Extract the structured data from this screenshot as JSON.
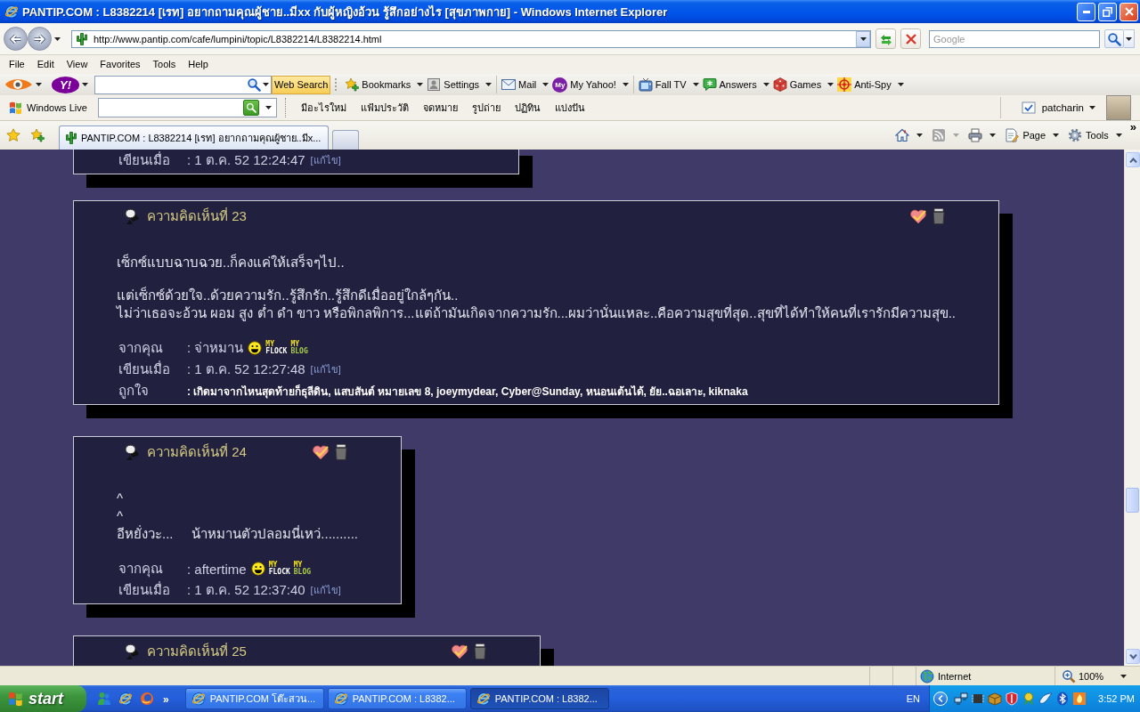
{
  "window": {
    "title": "PANTIP.COM : L8382214 [เรท] อยากถามคุณผู้ชาย..มีxx กับผู้หญิงอ้วน รู้สึกอย่างไร [สุขภาพกาย] - Windows Internet Explorer"
  },
  "address_bar": {
    "url": "http://www.pantip.com/cafe/lumpini/topic/L8382214/L8382214.html"
  },
  "search": {
    "placeholder": "Google"
  },
  "menu": [
    "File",
    "Edit",
    "View",
    "Favorites",
    "Tools",
    "Help"
  ],
  "yahoo_toolbar": {
    "logo": "Y!",
    "search_button": "Web Search",
    "items": [
      {
        "kind": "button",
        "label": "Bookmarks"
      },
      {
        "kind": "button",
        "label": "Settings"
      },
      {
        "kind": "separator"
      },
      {
        "kind": "button",
        "label": "Mail"
      },
      {
        "kind": "button",
        "label": "My Yahoo!",
        "logo": "My"
      },
      {
        "kind": "separator"
      },
      {
        "kind": "button",
        "label": "Fall TV"
      },
      {
        "kind": "button",
        "label": "Answers"
      },
      {
        "kind": "button",
        "label": "Games"
      },
      {
        "kind": "button",
        "label": "Anti-Spy"
      }
    ]
  },
  "live_toolbar": {
    "brand": "Windows Live",
    "links": [
      "มีอะไรใหม่",
      "แฟ้มประวัติ",
      "จดหมาย",
      "รูปถ่าย",
      "ปฏิทิน",
      "แบ่งปัน"
    ],
    "user": "patcharin"
  },
  "tabs": [
    {
      "label": "PANTIP.COM : L8382214 [เรท] อยากถามคุณผู้ชาย..มีx...",
      "selected": true
    }
  ],
  "command_bar": {
    "items": [
      {
        "disabled": false
      },
      {
        "disabled": true
      },
      {
        "disabled": false
      },
      {
        "label": "Page",
        "disabled": false
      },
      {
        "label": "Tools",
        "disabled": false
      }
    ],
    "more": "»"
  },
  "comments": [
    {
      "meta": [
        {
          "kind": "written",
          "label": "เขียนเมื่อ",
          "value": ": 1 ต.ค. 52 12:24:47",
          "edit": "[แก้ไข]"
        }
      ]
    },
    {
      "title": "ความคิดเห็นที่ 23",
      "body": [
        [
          "เซ็กซ์แบบฉาบฉวย..ก็คงแค่ให้เสร็จๆไป.."
        ],
        [
          "แต่เซ็กซ์ด้วยใจ..ด้วยความรัก..รู้สึกรัก..รู้สึกดีเมื่ออยู่ใกล้ๆกัน..",
          "ไม่ว่าเธอจะอ้วน ผอม สูง ต่ำ ดำ ขาว หรือพิกลพิการ...แต่ถ้ามันเกิดจากความรัก...ผมว่านั่นแหละ..คือความสุขที่สุด..สุขที่ได้ทำให้คนที่เรารักมีความสุข.."
        ]
      ],
      "meta": [
        {
          "kind": "author",
          "label": "จากคุณ",
          "value": ": จ่าหมาน",
          "logos": [
            {
              "top": "MY",
              "bottom": "FLOCK"
            },
            {
              "top": "MY",
              "bottom": "BLOG"
            }
          ]
        },
        {
          "kind": "written",
          "label": "เขียนเมื่อ",
          "value": ": 1 ต.ค. 52 12:27:48",
          "edit": "[แก้ไข]"
        },
        {
          "kind": "likes",
          "label": "ถูกใจ",
          "value": ": เกิดมาจากไหนสุดท้ายก็ธุลีดิน, แสบสันต์ หมายเลข 8, joeymydear, Cyber@Sunday, หนอนเต้นได้, ยัย..ฉอเลาะ, kiknaka"
        }
      ]
    },
    {
      "title": "ความคิดเห็นที่ 24",
      "body": [
        [
          "^",
          "^",
          "อีหยั่งวะ...     น้าหมานตัวปลอมนี่เหว่.........."
        ]
      ],
      "meta": [
        {
          "kind": "author",
          "label": "จากคุณ",
          "value": ": aftertime",
          "logos": [
            {
              "top": "MY",
              "bottom": "FLOCK"
            },
            {
              "top": "MY",
              "bottom": "BLOG"
            }
          ]
        },
        {
          "kind": "written",
          "label": "เขียนเมื่อ",
          "value": ": 1 ต.ค. 52 12:37:40",
          "edit": "[แก้ไข]"
        }
      ]
    },
    {
      "title": "ความคิดเห็นที่ 25"
    }
  ],
  "status_bar": {
    "zone": "Internet",
    "zoom": "100%"
  },
  "taskbar": {
    "start": "start",
    "more": "»",
    "tasks": [
      {
        "label": "PANTIP.COM โต๊ะสวน...",
        "selected": false
      },
      {
        "label": "PANTIP.COM : L8382...",
        "selected": false
      },
      {
        "label": "PANTIP.COM : L8382...",
        "selected": true
      }
    ],
    "language": "EN",
    "clock": "3:52 PM"
  }
}
